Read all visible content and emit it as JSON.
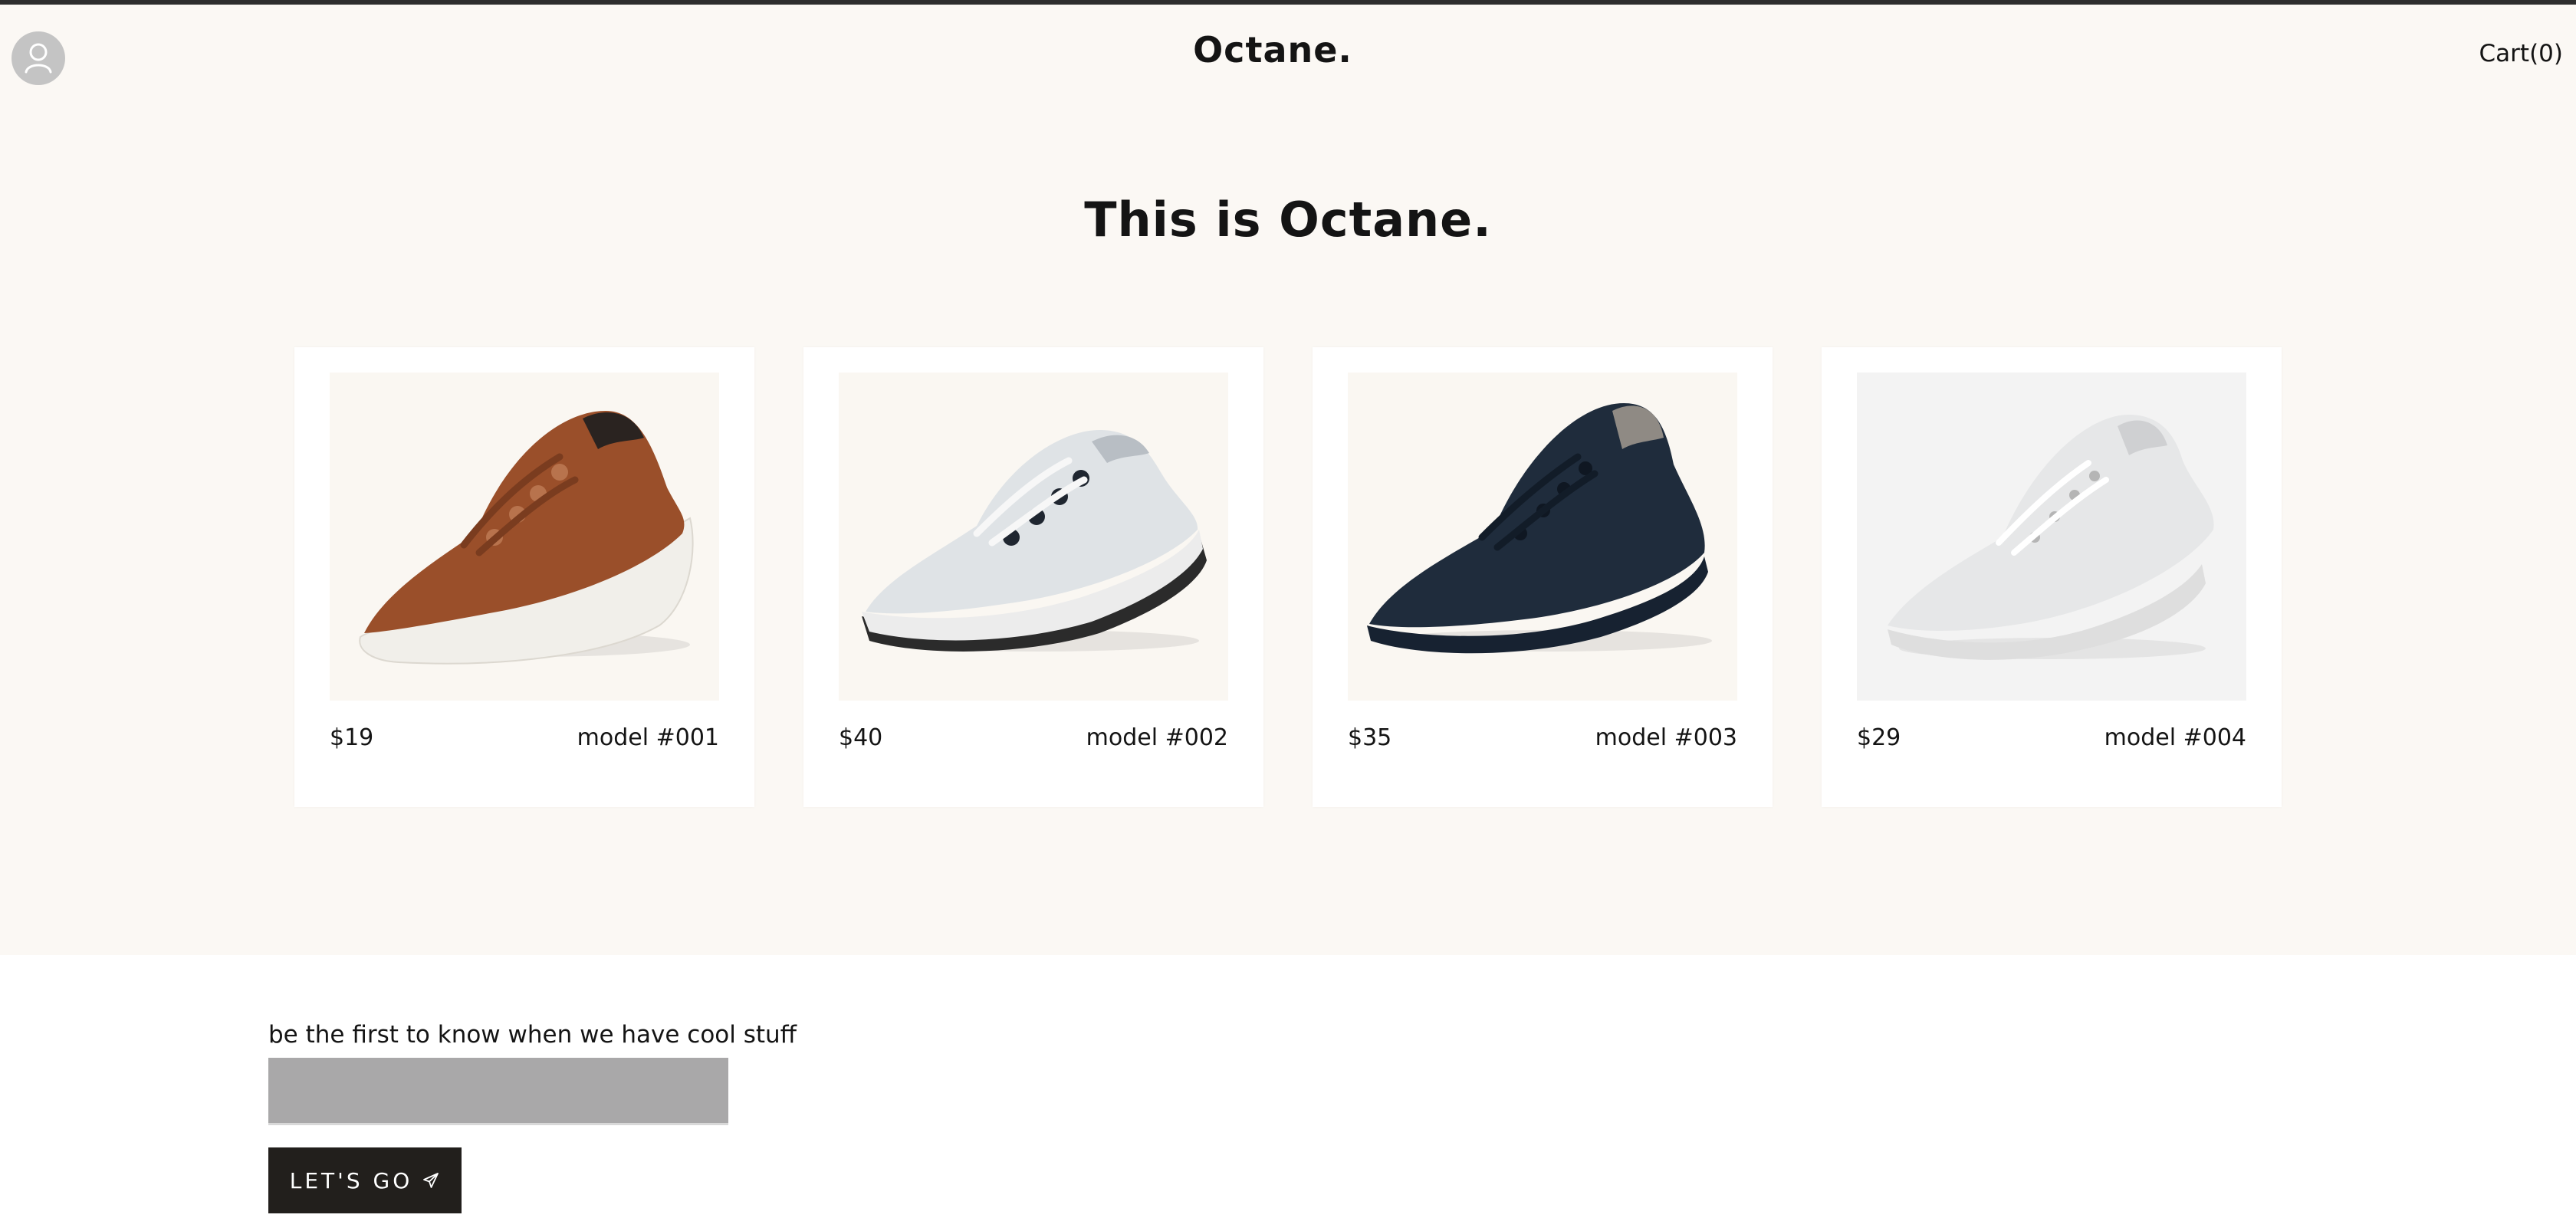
{
  "header": {
    "logo": "Octane.",
    "cart_label": "Cart(0)"
  },
  "hero": {
    "title": "This is Octane."
  },
  "products": [
    {
      "price": "$19",
      "model": "model #001",
      "image": "sneaker-rust-brown",
      "color": "#9a4f2a"
    },
    {
      "price": "$40",
      "model": "model #002",
      "image": "sneaker-light-grey",
      "color": "#dfe3e6"
    },
    {
      "price": "$35",
      "model": "model #003",
      "image": "sneaker-navy",
      "color": "#1f2c3c"
    },
    {
      "price": "$29",
      "model": "model #004",
      "image": "sneaker-white",
      "color": "#e6e7e8"
    }
  ],
  "newsletter": {
    "label": "be the first to know when we have cool stuff",
    "input_value": "",
    "button_label": "LET'S GO",
    "button_icon": "send-icon"
  },
  "colors": {
    "hero_bg": "#fbf8f4",
    "button_bg": "#221f1c",
    "input_bg": "#a9a8a9",
    "avatar_bg": "#c4c4c4"
  }
}
